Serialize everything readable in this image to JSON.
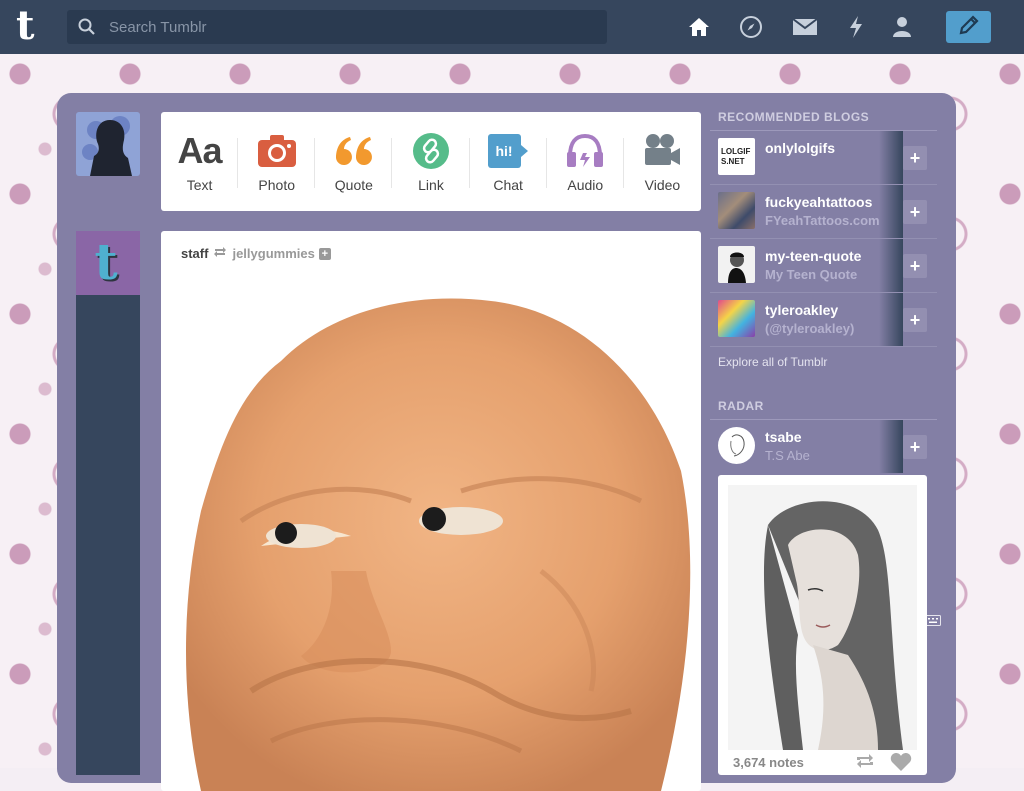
{
  "search": {
    "placeholder": "Search Tumblr"
  },
  "nav": {
    "icons": [
      "home-icon",
      "compass-icon",
      "mail-icon",
      "lightning-icon",
      "person-icon",
      "pencil-icon"
    ]
  },
  "post_types": [
    {
      "label": "Text",
      "icon": "text-icon"
    },
    {
      "label": "Photo",
      "icon": "camera-icon"
    },
    {
      "label": "Quote",
      "icon": "quote-icon"
    },
    {
      "label": "Link",
      "icon": "link-icon"
    },
    {
      "label": "Chat",
      "icon": "chat-icon"
    },
    {
      "label": "Audio",
      "icon": "headphones-icon"
    },
    {
      "label": "Video",
      "icon": "video-camera-icon"
    }
  ],
  "post": {
    "author": "staff",
    "source": "jellygummies"
  },
  "recommended": {
    "heading": "RECOMMENDED BLOGS",
    "blogs": [
      {
        "name": "onlylolgifs",
        "subtitle": "",
        "thumb_text": "LOLGIFS.NET"
      },
      {
        "name": "fuckyeahtattoos",
        "subtitle": "FYeahTattoos.com"
      },
      {
        "name": "my-teen-quote",
        "subtitle": "My Teen Quote"
      },
      {
        "name": "tyleroakley",
        "subtitle": "(@tyleroakley)"
      }
    ],
    "explore": "Explore all of Tumblr"
  },
  "radar": {
    "heading": "RADAR",
    "name": "tsabe",
    "subtitle": "T.S Abe",
    "notes": "3,674 notes"
  },
  "colors": {
    "navbar": "#36465d",
    "panel": "#837fa5",
    "accent": "#529ecc"
  }
}
